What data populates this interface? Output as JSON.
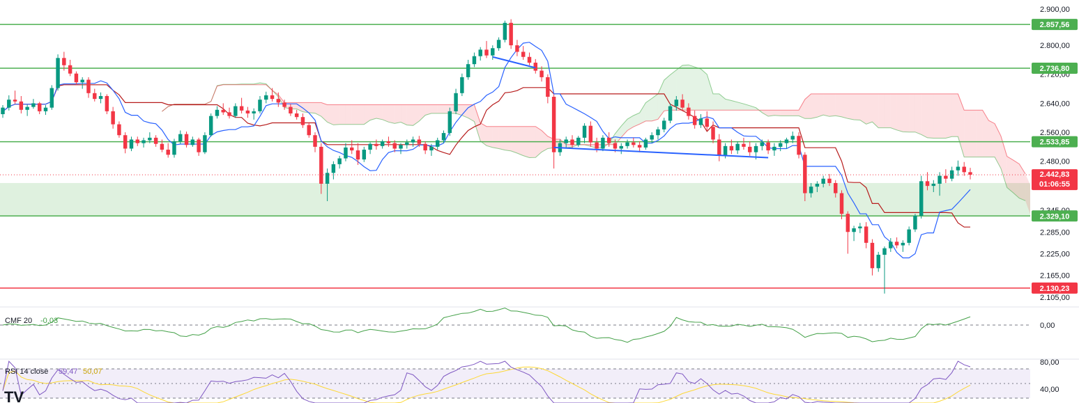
{
  "chart_data": {
    "type": "candlestick",
    "price_scale": {
      "ylim": [
        2080,
        2925
      ],
      "tick_labels": [
        "2.900,00",
        "2.800,00",
        "2.720,00",
        "2.640,00",
        "2.560,00",
        "2.480,00",
        "2.345,00",
        "2.285,00",
        "2.225,00",
        "2.165,00",
        "2.105,00"
      ],
      "tick_values": [
        2900,
        2800,
        2720,
        2640,
        2560,
        2480,
        2345,
        2285,
        2225,
        2165,
        2105
      ]
    },
    "levels": [
      {
        "label": "2.857,56",
        "value": 2857.56,
        "color": "#4caf50"
      },
      {
        "label": "2.736,80",
        "value": 2736.8,
        "color": "#4caf50"
      },
      {
        "label": "2.533,85",
        "value": 2533.85,
        "color": "#4caf50"
      },
      {
        "label": "2.329,10",
        "value": 2329.1,
        "color": "#4caf50"
      },
      {
        "label": "2.130,23",
        "value": 2130.23,
        "color": "#f23645"
      }
    ],
    "current_price": {
      "label": "2.442,83",
      "value": 2442.83,
      "countdown": "01:06:55",
      "color": "#f23645"
    },
    "support_zone": {
      "from": 2329.1,
      "to": 2420
    },
    "colors": {
      "up": "#089981",
      "down": "#f23645",
      "tenkan": "#2962ff",
      "kijun": "#b71c1c",
      "cloud_bull": "#4caf50",
      "cloud_bear": "#f23645",
      "trendline": "#2962ff",
      "cmf": "#43a047",
      "rsi": "#7e57c2",
      "rsi_ma": "#fdd835"
    },
    "candles": [
      [
        2610,
        2635,
        2600,
        2628
      ],
      [
        2628,
        2662,
        2620,
        2650
      ],
      [
        2650,
        2675,
        2638,
        2645
      ],
      [
        2645,
        2660,
        2612,
        2622
      ],
      [
        2622,
        2636,
        2605,
        2630
      ],
      [
        2630,
        2652,
        2625,
        2640
      ],
      [
        2640,
        2644,
        2610,
        2618
      ],
      [
        2618,
        2635,
        2608,
        2628
      ],
      [
        2628,
        2690,
        2622,
        2682
      ],
      [
        2682,
        2775,
        2675,
        2765
      ],
      [
        2765,
        2782,
        2730,
        2745
      ],
      [
        2745,
        2760,
        2715,
        2722
      ],
      [
        2722,
        2728,
        2690,
        2698
      ],
      [
        2698,
        2712,
        2680,
        2705
      ],
      [
        2705,
        2712,
        2655,
        2668
      ],
      [
        2668,
        2680,
        2645,
        2652
      ],
      [
        2652,
        2670,
        2640,
        2660
      ],
      [
        2660,
        2665,
        2610,
        2618
      ],
      [
        2618,
        2630,
        2570,
        2582
      ],
      [
        2582,
        2590,
        2545,
        2552
      ],
      [
        2552,
        2560,
        2502,
        2515
      ],
      [
        2515,
        2548,
        2508,
        2540
      ],
      [
        2540,
        2548,
        2522,
        2530
      ],
      [
        2530,
        2545,
        2518,
        2538
      ],
      [
        2538,
        2560,
        2530,
        2545
      ],
      [
        2545,
        2552,
        2520,
        2528
      ],
      [
        2528,
        2540,
        2505,
        2512
      ],
      [
        2512,
        2530,
        2490,
        2498
      ],
      [
        2498,
        2542,
        2490,
        2535
      ],
      [
        2535,
        2565,
        2528,
        2555
      ],
      [
        2555,
        2562,
        2518,
        2525
      ],
      [
        2525,
        2548,
        2520,
        2540
      ],
      [
        2540,
        2545,
        2495,
        2505
      ],
      [
        2505,
        2560,
        2500,
        2552
      ],
      [
        2552,
        2612,
        2548,
        2605
      ],
      [
        2605,
        2632,
        2598,
        2622
      ],
      [
        2622,
        2640,
        2608,
        2615
      ],
      [
        2615,
        2628,
        2598,
        2605
      ],
      [
        2605,
        2640,
        2600,
        2632
      ],
      [
        2632,
        2655,
        2612,
        2620
      ],
      [
        2620,
        2630,
        2600,
        2612
      ],
      [
        2612,
        2626,
        2595,
        2618
      ],
      [
        2618,
        2660,
        2612,
        2650
      ],
      [
        2650,
        2672,
        2640,
        2662
      ],
      [
        2662,
        2682,
        2645,
        2652
      ],
      [
        2652,
        2670,
        2630,
        2642
      ],
      [
        2642,
        2650,
        2622,
        2630
      ],
      [
        2630,
        2638,
        2605,
        2612
      ],
      [
        2612,
        2622,
        2595,
        2602
      ],
      [
        2602,
        2612,
        2572,
        2580
      ],
      [
        2580,
        2588,
        2545,
        2552
      ],
      [
        2552,
        2560,
        2505,
        2520
      ],
      [
        2520,
        2530,
        2390,
        2418
      ],
      [
        2418,
        2460,
        2370,
        2448
      ],
      [
        2448,
        2480,
        2430,
        2472
      ],
      [
        2472,
        2495,
        2460,
        2488
      ],
      [
        2488,
        2530,
        2480,
        2518
      ],
      [
        2518,
        2538,
        2500,
        2510
      ],
      [
        2510,
        2530,
        2470,
        2485
      ],
      [
        2485,
        2520,
        2478,
        2512
      ],
      [
        2512,
        2532,
        2500,
        2528
      ],
      [
        2528,
        2540,
        2512,
        2522
      ],
      [
        2522,
        2540,
        2515,
        2535
      ],
      [
        2535,
        2548,
        2520,
        2530
      ],
      [
        2530,
        2538,
        2505,
        2515
      ],
      [
        2515,
        2530,
        2500,
        2525
      ],
      [
        2525,
        2540,
        2515,
        2532
      ],
      [
        2532,
        2548,
        2520,
        2540
      ],
      [
        2540,
        2550,
        2520,
        2528
      ],
      [
        2528,
        2535,
        2500,
        2510
      ],
      [
        2510,
        2528,
        2495,
        2520
      ],
      [
        2520,
        2545,
        2512,
        2538
      ],
      [
        2538,
        2565,
        2530,
        2558
      ],
      [
        2558,
        2628,
        2550,
        2618
      ],
      [
        2618,
        2680,
        2610,
        2668
      ],
      [
        2668,
        2722,
        2660,
        2712
      ],
      [
        2712,
        2760,
        2705,
        2748
      ],
      [
        2748,
        2780,
        2740,
        2770
      ],
      [
        2770,
        2795,
        2758,
        2788
      ],
      [
        2788,
        2812,
        2765,
        2772
      ],
      [
        2772,
        2800,
        2760,
        2792
      ],
      [
        2792,
        2822,
        2785,
        2815
      ],
      [
        2815,
        2868,
        2808,
        2862
      ],
      [
        2862,
        2872,
        2790,
        2800
      ],
      [
        2800,
        2815,
        2770,
        2782
      ],
      [
        2782,
        2798,
        2760,
        2768
      ],
      [
        2768,
        2780,
        2745,
        2752
      ],
      [
        2752,
        2762,
        2722,
        2730
      ],
      [
        2730,
        2742,
        2700,
        2712
      ],
      [
        2712,
        2720,
        2640,
        2658
      ],
      [
        2658,
        2665,
        2460,
        2505
      ],
      [
        2505,
        2540,
        2495,
        2530
      ],
      [
        2530,
        2548,
        2518,
        2540
      ],
      [
        2540,
        2552,
        2515,
        2525
      ],
      [
        2525,
        2550,
        2520,
        2545
      ],
      [
        2545,
        2585,
        2530,
        2578
      ],
      [
        2578,
        2590,
        2520,
        2532
      ],
      [
        2532,
        2545,
        2505,
        2515
      ],
      [
        2515,
        2552,
        2508,
        2545
      ],
      [
        2545,
        2560,
        2520,
        2530
      ],
      [
        2530,
        2540,
        2505,
        2515
      ],
      [
        2515,
        2530,
        2500,
        2522
      ],
      [
        2522,
        2540,
        2515,
        2532
      ],
      [
        2532,
        2545,
        2518,
        2525
      ],
      [
        2525,
        2535,
        2505,
        2518
      ],
      [
        2518,
        2545,
        2512,
        2540
      ],
      [
        2540,
        2560,
        2530,
        2552
      ],
      [
        2552,
        2575,
        2540,
        2568
      ],
      [
        2568,
        2600,
        2560,
        2592
      ],
      [
        2592,
        2640,
        2585,
        2632
      ],
      [
        2632,
        2660,
        2620,
        2650
      ],
      [
        2650,
        2665,
        2618,
        2628
      ],
      [
        2628,
        2640,
        2595,
        2605
      ],
      [
        2605,
        2620,
        2570,
        2580
      ],
      [
        2580,
        2610,
        2572,
        2598
      ],
      [
        2598,
        2618,
        2565,
        2575
      ],
      [
        2575,
        2590,
        2530,
        2540
      ],
      [
        2540,
        2555,
        2480,
        2495
      ],
      [
        2495,
        2530,
        2488,
        2522
      ],
      [
        2522,
        2540,
        2500,
        2510
      ],
      [
        2510,
        2535,
        2500,
        2528
      ],
      [
        2528,
        2545,
        2512,
        2520
      ],
      [
        2520,
        2535,
        2495,
        2505
      ],
      [
        2505,
        2530,
        2485,
        2522
      ],
      [
        2522,
        2540,
        2510,
        2532
      ],
      [
        2532,
        2540,
        2500,
        2510
      ],
      [
        2510,
        2530,
        2495,
        2520
      ],
      [
        2520,
        2538,
        2508,
        2530
      ],
      [
        2530,
        2545,
        2515,
        2540
      ],
      [
        2540,
        2562,
        2530,
        2550
      ],
      [
        2550,
        2560,
        2488,
        2498
      ],
      [
        2498,
        2505,
        2370,
        2392
      ],
      [
        2392,
        2420,
        2380,
        2410
      ],
      [
        2410,
        2425,
        2395,
        2418
      ],
      [
        2418,
        2440,
        2408,
        2432
      ],
      [
        2432,
        2445,
        2412,
        2420
      ],
      [
        2420,
        2428,
        2380,
        2392
      ],
      [
        2392,
        2400,
        2320,
        2335
      ],
      [
        2335,
        2342,
        2225,
        2285
      ],
      [
        2285,
        2302,
        2260,
        2295
      ],
      [
        2295,
        2310,
        2282,
        2300
      ],
      [
        2300,
        2312,
        2240,
        2255
      ],
      [
        2255,
        2265,
        2165,
        2185
      ],
      [
        2185,
        2230,
        2175,
        2222
      ],
      [
        2222,
        2245,
        2115,
        2240
      ],
      [
        2240,
        2268,
        2230,
        2258
      ],
      [
        2258,
        2270,
        2240,
        2248
      ],
      [
        2248,
        2262,
        2230,
        2255
      ],
      [
        2255,
        2300,
        2248,
        2292
      ],
      [
        2292,
        2335,
        2285,
        2330
      ],
      [
        2330,
        2440,
        2322,
        2425
      ],
      [
        2425,
        2450,
        2400,
        2412
      ],
      [
        2412,
        2428,
        2395,
        2418
      ],
      [
        2418,
        2450,
        2385,
        2440
      ],
      [
        2440,
        2458,
        2420,
        2432
      ],
      [
        2432,
        2465,
        2425,
        2455
      ],
      [
        2455,
        2482,
        2440,
        2465
      ],
      [
        2465,
        2478,
        2440,
        2450
      ],
      [
        2450,
        2462,
        2430,
        2443
      ]
    ],
    "indicators": [
      {
        "name": "CMF 20",
        "value_label": "-0,03",
        "scale_label": "0,00"
      },
      {
        "name": "RSI 14 close",
        "value_label": "59,47",
        "ma_label": "50,07",
        "scale_labels": [
          "80,00",
          "40,00"
        ]
      }
    ]
  },
  "logo": "TV"
}
